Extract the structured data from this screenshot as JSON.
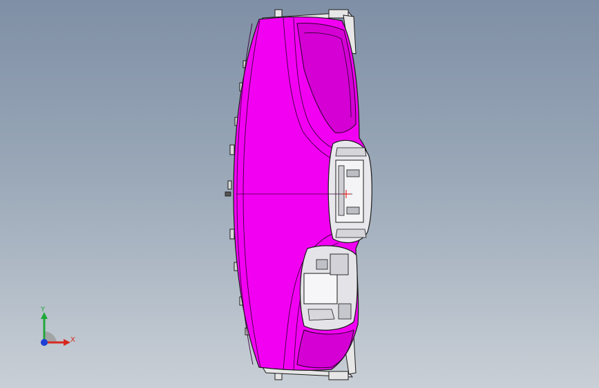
{
  "viewport": {
    "background_top": "#7f8fa5",
    "background_bottom": "#c9cfd6"
  },
  "model": {
    "body_color": "#f200f2",
    "edge_color": "#1a1a1a",
    "bracket_color": "#e6e6e6"
  },
  "triad": {
    "x_label": "X",
    "y_label": "Y",
    "x_color": "#d8281e",
    "y_color": "#1fa83a",
    "z_color": "#1c3fd6"
  }
}
